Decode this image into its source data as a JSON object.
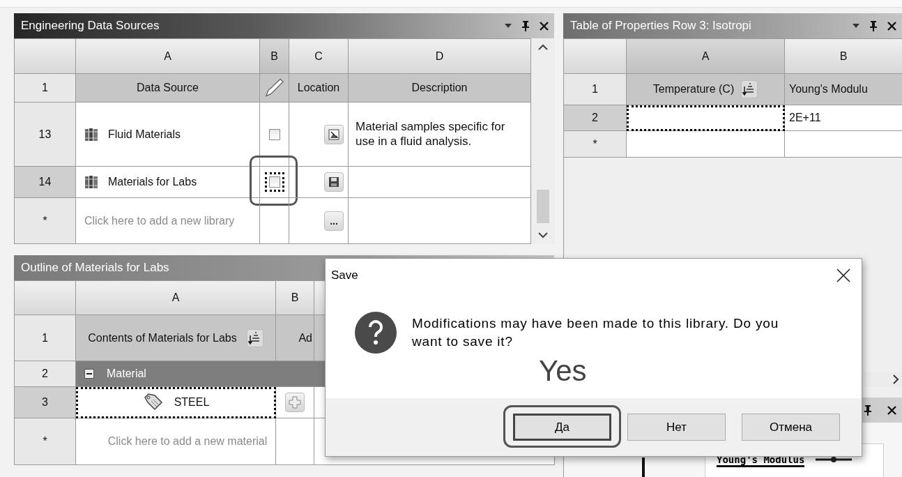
{
  "sources_panel": {
    "title": "Engineering Data Sources",
    "columns": [
      "A",
      "B",
      "C",
      "D"
    ],
    "header_row": {
      "number": "1",
      "data_source": "Data Source",
      "location": "Location",
      "description": "Description"
    },
    "rows": [
      {
        "number": "13",
        "name": "Fluid Materials",
        "checked": false,
        "focused": false,
        "callout": false,
        "selected": false,
        "kind": "image",
        "description": "Material samples specific for use in a fluid analysis."
      },
      {
        "number": "14",
        "name": "Materials for Labs",
        "checked": false,
        "focused": true,
        "callout": true,
        "selected": true,
        "kind": "save"
      }
    ],
    "new_row": {
      "number": "*",
      "placeholder": "Click here to add a new library",
      "browse_label": "..."
    }
  },
  "outline_panel": {
    "title": "Outline of Materials for Labs",
    "columns": [
      "A",
      "B"
    ],
    "header_row": {
      "number": "1",
      "contents": "Contents of Materials for Labs",
      "column_b": "Ad"
    },
    "group": {
      "number": "2",
      "label": "Material",
      "expanded": true
    },
    "rows": [
      {
        "number": "3",
        "name": "STEEL",
        "focused": true,
        "selected": true
      }
    ],
    "new_row": {
      "number": "*",
      "placeholder": "Click here to add a new material"
    }
  },
  "properties_panel": {
    "title": "Table of Properties Row 3: Isotropi",
    "columns": [
      "A",
      "B"
    ],
    "header_row": {
      "number": "1",
      "temperature": "Temperature (C)",
      "modulus": "Young's Modulu"
    },
    "rows": [
      {
        "number": "2",
        "focused": true,
        "selected": true,
        "modulus": "2E+11"
      }
    ],
    "new_row": {
      "number": "*"
    }
  },
  "chart_panel": {
    "legend": "Young's Modulus"
  },
  "dialog": {
    "title": "Save",
    "message": "Modifications may have been made to this library.  Do you want to save it?",
    "annotation": "Yes",
    "buttons": [
      {
        "label": "Да",
        "default": true,
        "callout": true
      },
      {
        "label": "Нет",
        "default": false,
        "callout": false
      },
      {
        "label": "Отмена",
        "default": false,
        "callout": false
      }
    ]
  }
}
